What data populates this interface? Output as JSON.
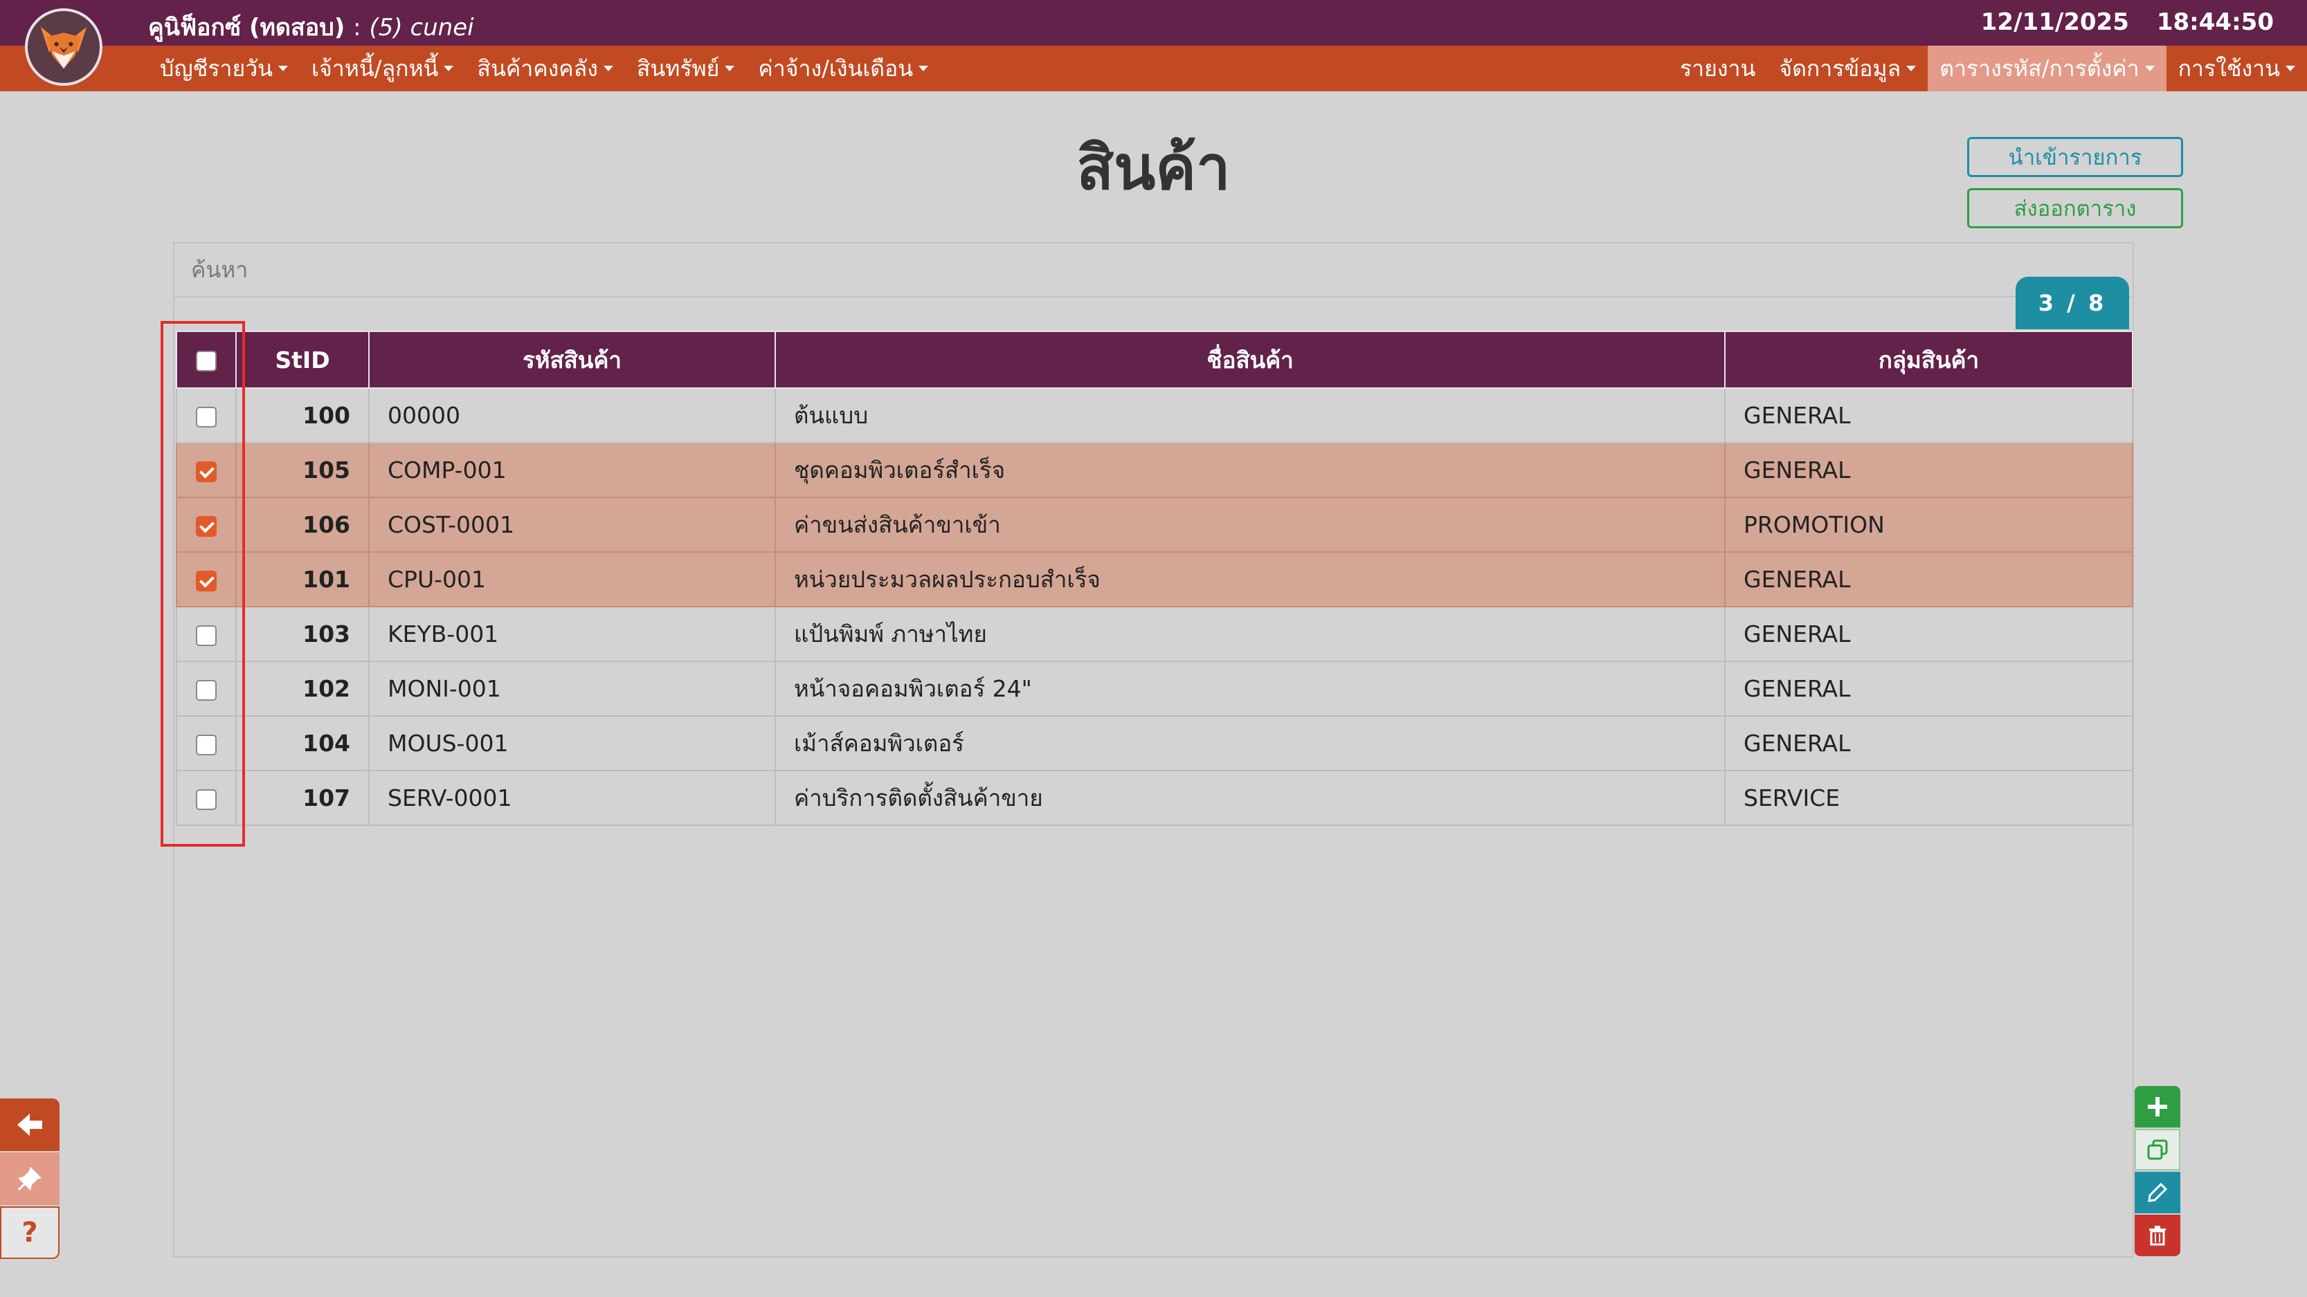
{
  "header": {
    "app_name": "คูนิฟ็อกซ์ (ทดสอบ)",
    "separator": ":",
    "user": "(5) cunei",
    "date": "12/11/2025",
    "time": "18:44:50"
  },
  "menu": {
    "left": [
      {
        "label": "บัญชีรายวัน",
        "caret": true
      },
      {
        "label": "เจ้าหนี้/ลูกหนี้",
        "caret": true
      },
      {
        "label": "สินค้าคงคลัง",
        "caret": true
      },
      {
        "label": "สินทรัพย์",
        "caret": true
      },
      {
        "label": "ค่าจ้าง/เงินเดือน",
        "caret": true
      }
    ],
    "right": [
      {
        "label": "รายงาน",
        "caret": false
      },
      {
        "label": "จัดการข้อมูล",
        "caret": true
      },
      {
        "label": "ตารางรหัส/การตั้งค่า",
        "caret": true,
        "active": true
      },
      {
        "label": "การใช้งาน",
        "caret": true
      }
    ]
  },
  "page": {
    "title": "สินค้า",
    "import_label": "นำเข้ารายการ",
    "export_label": "ส่งออกตาราง",
    "search_placeholder": "ค้นหา",
    "counter": "3 / 8"
  },
  "table": {
    "columns": [
      "StID",
      "รหัสสินค้า",
      "ชื่อสินค้า",
      "กลุ่มสินค้า"
    ],
    "rows": [
      {
        "checked": false,
        "stid": "100",
        "code": "00000",
        "name": "ต้นแบบ",
        "group": "GENERAL"
      },
      {
        "checked": true,
        "stid": "105",
        "code": "COMP-001",
        "name": "ชุดคอมพิวเตอร์สำเร็จ",
        "group": "GENERAL"
      },
      {
        "checked": true,
        "stid": "106",
        "code": "COST-0001",
        "name": "ค่าขนส่งสินค้าขาเข้า",
        "group": "PROMOTION"
      },
      {
        "checked": true,
        "stid": "101",
        "code": "CPU-001",
        "name": "หน่วยประมวลผลประกอบสำเร็จ",
        "group": "GENERAL"
      },
      {
        "checked": false,
        "stid": "103",
        "code": "KEYB-001",
        "name": "แป้นพิมพ์ ภาษาไทย",
        "group": "GENERAL"
      },
      {
        "checked": false,
        "stid": "102",
        "code": "MONI-001",
        "name": "หน้าจอคอมพิวเตอร์ 24\"",
        "group": "GENERAL"
      },
      {
        "checked": false,
        "stid": "104",
        "code": "MOUS-001",
        "name": "เม้าส์คอมพิวเตอร์",
        "group": "GENERAL"
      },
      {
        "checked": false,
        "stid": "107",
        "code": "SERV-0001",
        "name": "ค่าบริการติดตั้งสินค้าขาย",
        "group": "SERVICE"
      }
    ]
  },
  "side_buttons": {
    "back_icon": "arrow-left-icon",
    "pin_icon": "pin-icon",
    "help_label": "?"
  },
  "actions": {
    "add_icon": "plus-icon",
    "copy_icon": "copy-icon",
    "edit_icon": "pencil-icon",
    "delete_icon": "trash-icon"
  },
  "colors": {
    "header": "#62224a",
    "menu": "#c24a22",
    "selected_row": "#d4a696",
    "accent_teal": "#1e8fa3",
    "accent_green": "#2f9e43",
    "danger": "#c8342c"
  }
}
